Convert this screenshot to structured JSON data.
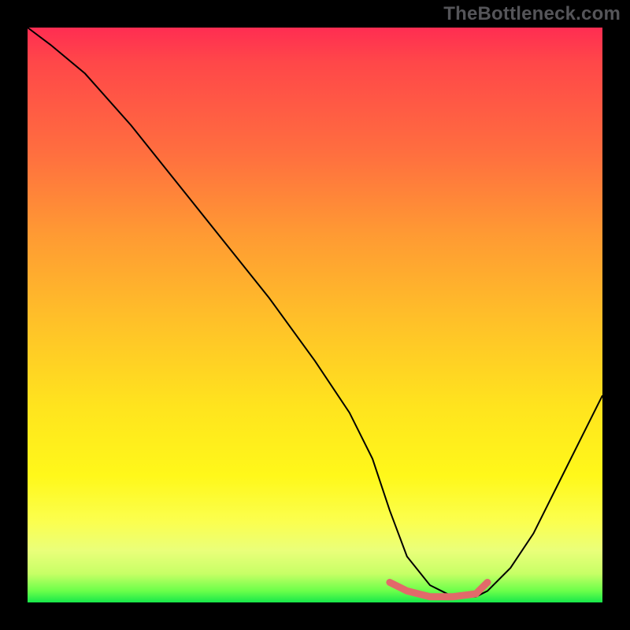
{
  "watermark": "TheBottleneck.com",
  "colors": {
    "curve": "#000000",
    "highlight": "#e26a6a",
    "frame": "#000000"
  },
  "chart_data": {
    "type": "line",
    "title": "",
    "xlabel": "",
    "ylabel": "",
    "xlim": [
      0,
      100
    ],
    "ylim": [
      0,
      100
    ],
    "grid": false,
    "series": [
      {
        "name": "bottleneck_curve",
        "x": [
          0,
          4,
          10,
          18,
          26,
          34,
          42,
          50,
          56,
          60,
          63,
          66,
          70,
          74,
          78,
          80,
          84,
          88,
          92,
          96,
          100
        ],
        "y": [
          100,
          97,
          92,
          83,
          73,
          63,
          53,
          42,
          33,
          25,
          16,
          8,
          3,
          1,
          1,
          2,
          6,
          12,
          20,
          28,
          36
        ]
      },
      {
        "name": "optimal_range",
        "x": [
          63,
          66,
          70,
          74,
          78,
          80
        ],
        "y": [
          3.5,
          2,
          1,
          1,
          1.5,
          3.5
        ]
      }
    ],
    "note": "y is plotted with 0 at bottom, 100 at top; curve descends from top-left to a trough near x≈72 then rises toward the right edge"
  }
}
